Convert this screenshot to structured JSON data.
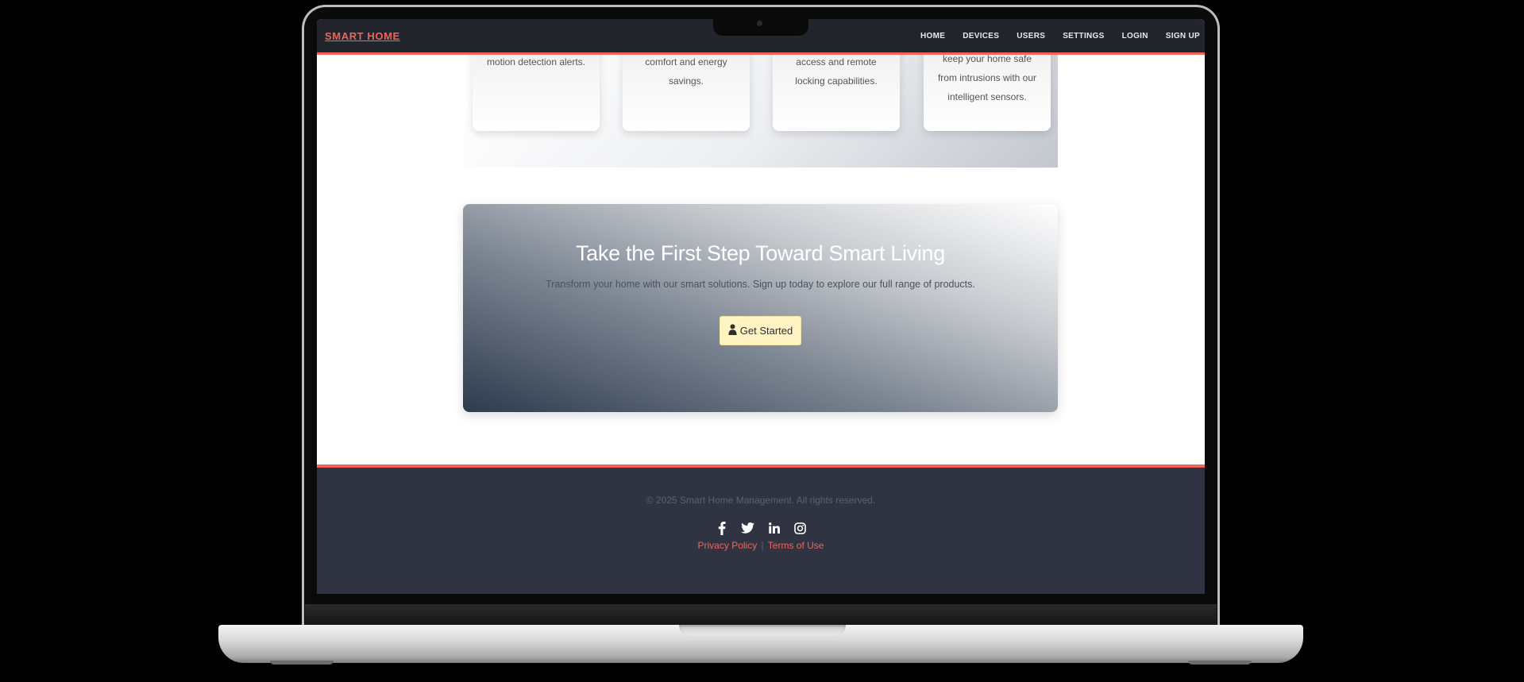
{
  "navbar": {
    "brand": "SMART HOME",
    "links": [
      "HOME",
      "DEVICES",
      "USERS",
      "SETTINGS",
      "LOGIN",
      "SIGN UP"
    ]
  },
  "features": {
    "cards": [
      {
        "text": "motion detection alerts."
      },
      {
        "text": "comfort and energy savings."
      },
      {
        "text": "access and remote locking capabilities."
      },
      {
        "text": "keep your home safe from intrusions with our intelligent sensors."
      }
    ]
  },
  "cta": {
    "title": "Take the First Step Toward Smart Living",
    "text": "Transform your home with our smart solutions. Sign up today to explore our full range of products.",
    "button_label": "Get Started",
    "button_icon": "user-icon"
  },
  "footer": {
    "copyright": "© 2025 Smart Home Management. All rights reserved.",
    "social_icons": [
      "facebook-icon",
      "twitter-icon",
      "linkedin-icon",
      "instagram-icon"
    ],
    "privacy_label": "Privacy Policy",
    "separator": "|",
    "terms_label": "Terms of Use"
  },
  "colors": {
    "accent": "#f0645a",
    "navbar_bg": "#22252c",
    "footer_bg": "#303442",
    "button_bg": "#fff4c2"
  }
}
